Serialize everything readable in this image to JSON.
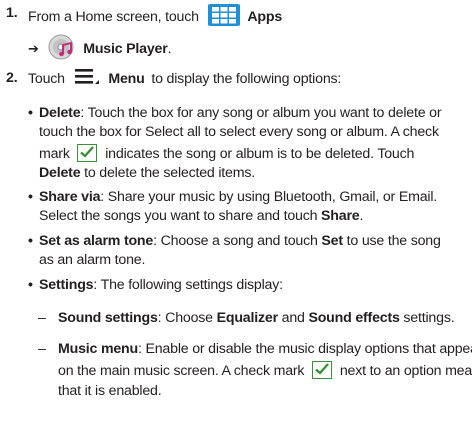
{
  "step1": {
    "num": "1.",
    "pre": "From a Home screen, touch",
    "apps_label": "Apps",
    "arrow": "➔",
    "music_player_label": "Music Player",
    "period": "."
  },
  "step2": {
    "num": "2.",
    "pre": "Touch",
    "menu_label": "Menu",
    "post": "to display the following options:"
  },
  "bullets": {
    "delete": {
      "term": "Delete",
      "l1": ": Touch the box for any song or album you want to delete or",
      "l2": "touch the box for Select all to select every song or album. A check",
      "l3a": "mark",
      "l3b": "indicates the song or album is to be deleted. Touch",
      "l4a": "Delete",
      "l4b": " to delete the selected items."
    },
    "share": {
      "term": "Share via",
      "l1": ": Share your music by using Bluetooth, Gmail, or Email.",
      "l2a": "Select the songs you want to share and touch ",
      "l2b": "Share",
      "l2c": "."
    },
    "alarm": {
      "term": "Set as alarm tone",
      "l1a": ": Choose a song and touch ",
      "l1b": "Set",
      "l1c": " to use the song",
      "l2": "as an alarm tone."
    },
    "settings": {
      "term": "Settings",
      "l1": ": The following settings display:"
    }
  },
  "subbullets": {
    "sound": {
      "dash": "–",
      "term": "Sound settings",
      "t1": ": Choose ",
      "t2": "Equalizer",
      "t3": " and ",
      "t4": "Sound effects",
      "t5": " settings."
    },
    "music_menu": {
      "dash": "–",
      "term": "Music menu",
      "l1": ": Enable or disable the music display options that appear",
      "l2": "on the main music screen. A check mark",
      "l2b": "next to an option means",
      "l3": "that it is enabled."
    }
  },
  "bullet_char": "•",
  "icons": {
    "apps": "apps-grid-icon",
    "music_player": "music-player-icon",
    "menu": "menu-icon",
    "checkmark": "check-mark-icon"
  },
  "colors": {
    "apps_icon_bg": "#1f8fd6",
    "check_green": "#3a8f3a"
  }
}
